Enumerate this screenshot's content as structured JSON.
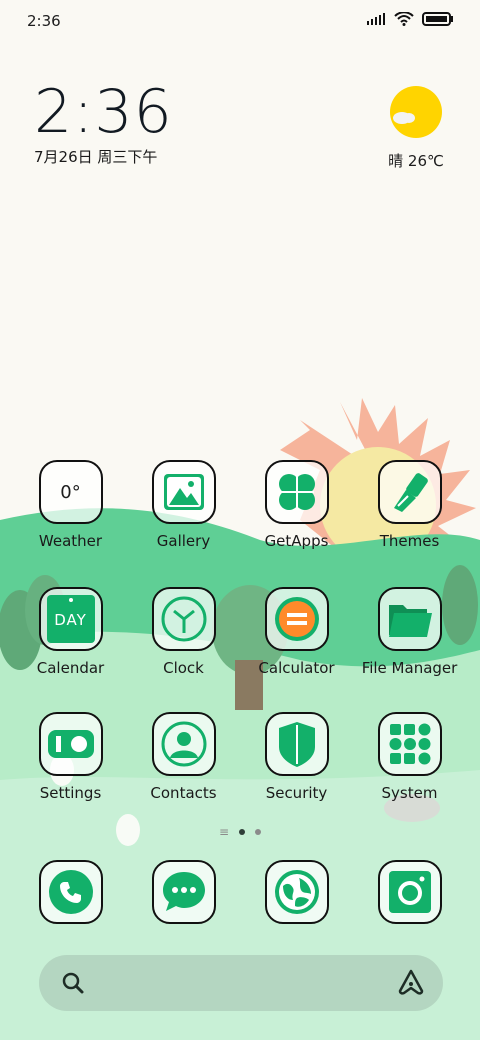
{
  "status_bar": {
    "time": "2:36"
  },
  "clock_widget": {
    "time": "2:36",
    "date": "7月26日 周三下午"
  },
  "weather_widget": {
    "label": "晴 26℃",
    "sun_color": "#ffd400"
  },
  "apps": [
    {
      "label": "Weather",
      "icon": "weather-icon",
      "badge": "0°"
    },
    {
      "label": "Gallery",
      "icon": "gallery-icon"
    },
    {
      "label": "GetApps",
      "icon": "getapps-icon"
    },
    {
      "label": "Themes",
      "icon": "themes-icon"
    },
    {
      "label": "Calendar",
      "icon": "calendar-icon",
      "badge": "DAY"
    },
    {
      "label": "Clock",
      "icon": "clock-icon"
    },
    {
      "label": "Calculator",
      "icon": "calculator-icon"
    },
    {
      "label": "File Manager",
      "icon": "file-manager-icon"
    },
    {
      "label": "Settings",
      "icon": "settings-icon"
    },
    {
      "label": "Contacts",
      "icon": "contacts-icon"
    },
    {
      "label": "Security",
      "icon": "security-icon"
    },
    {
      "label": "System",
      "icon": "system-folder-icon"
    }
  ],
  "dock": [
    {
      "icon": "phone-icon"
    },
    {
      "icon": "messages-icon"
    },
    {
      "icon": "browser-icon"
    },
    {
      "icon": "camera-icon"
    }
  ],
  "pagination": {
    "total_pages": 3,
    "active_page": 2
  },
  "colors": {
    "accent_green": "#13b06a",
    "grass": "#5fcf95",
    "sky": "#faf9f3",
    "orange": "#ff8a2a"
  }
}
